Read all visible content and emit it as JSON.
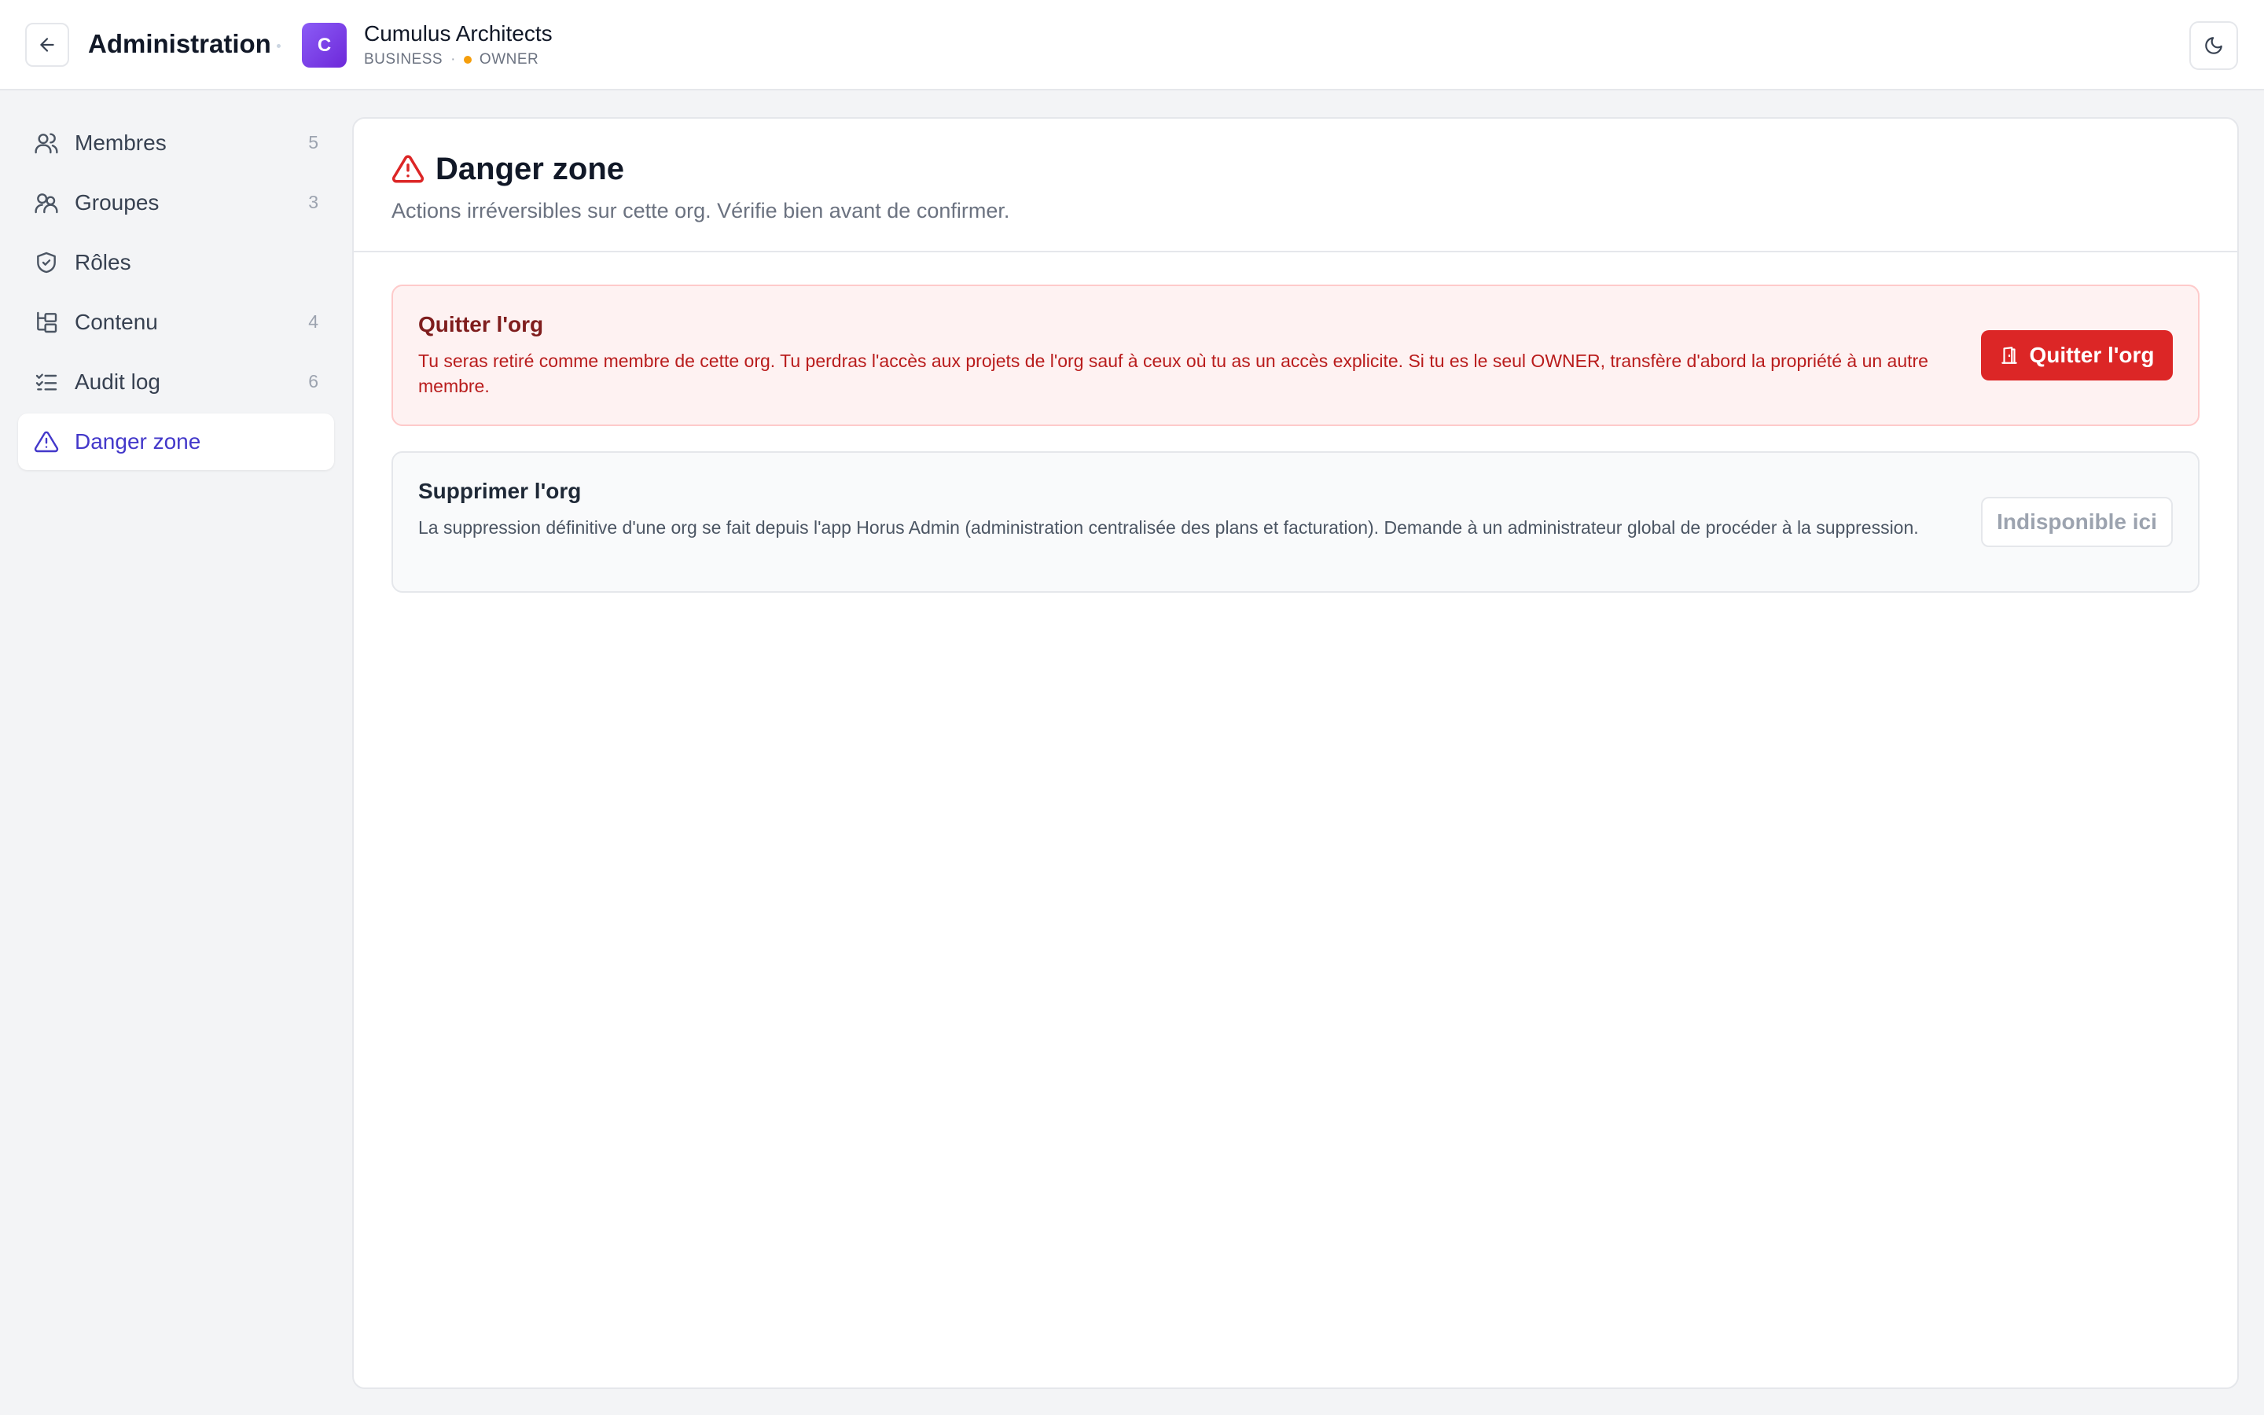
{
  "header": {
    "title": "Administration",
    "org": {
      "initial": "C",
      "name": "Cumulus Architects",
      "plan": "BUSINESS",
      "role": "OWNER"
    },
    "back_icon": "arrow-left-icon",
    "theme_icon": "moon-icon"
  },
  "sidebar": {
    "items": [
      {
        "label": "Membres",
        "count": "5",
        "icon": "users-icon"
      },
      {
        "label": "Groupes",
        "count": "3",
        "icon": "group-icon"
      },
      {
        "label": "Rôles",
        "count": "",
        "icon": "shield-check-icon"
      },
      {
        "label": "Contenu",
        "count": "4",
        "icon": "folder-tree-icon"
      },
      {
        "label": "Audit log",
        "count": "6",
        "icon": "list-checks-icon"
      },
      {
        "label": "Danger zone",
        "count": "",
        "icon": "alert-triangle-icon",
        "active": true
      }
    ]
  },
  "main": {
    "title": "Danger zone",
    "subtitle": "Actions irréversibles sur cette org. Vérifie bien avant de confirmer.",
    "leave": {
      "title": "Quitter l'org",
      "description": "Tu seras retiré comme membre de cette org. Tu perdras l'accès aux projets de l'org sauf à ceux où tu as un accès explicite. Si tu es le seul OWNER, transfère d'abord la propriété à un autre membre.",
      "button_label": "Quitter l'org",
      "button_icon": "door-exit-icon"
    },
    "delete": {
      "title": "Supprimer l'org",
      "description": "La suppression définitive d'une org se fait depuis l'app Horus Admin (administration centralisée des plans et facturation). Demande à un administrateur global de procéder à la suppression.",
      "button_label": "Indisponible ici"
    }
  },
  "colors": {
    "accent": "#4338ca",
    "danger": "#dc2626",
    "danger_bg": "#fef2f2",
    "avatar": "#7c3aed",
    "owner_dot": "#f59e0b"
  }
}
